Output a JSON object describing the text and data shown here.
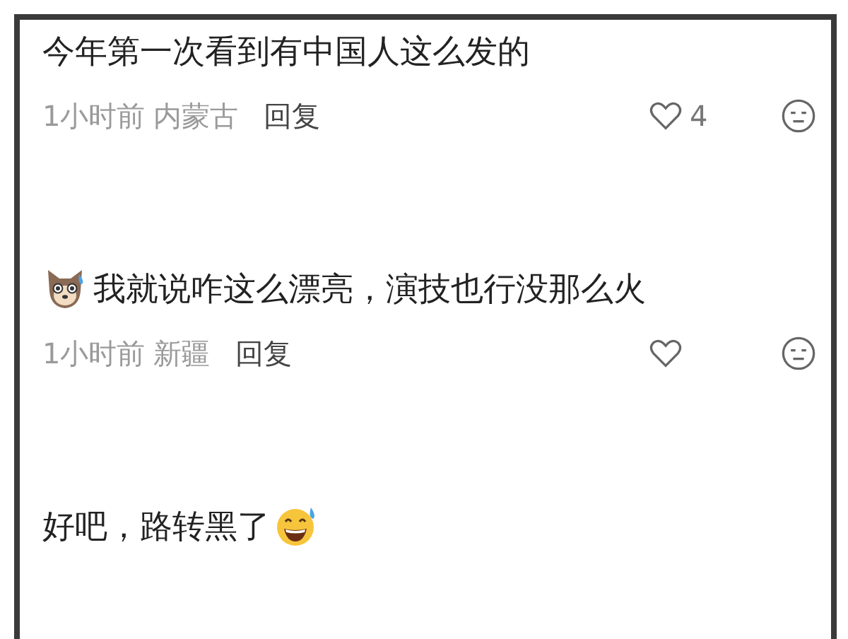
{
  "comments": [
    {
      "kind": "plain",
      "text": "今年第一次看到有中国人这么发的",
      "time": "1小时前",
      "location": "内蒙古",
      "reply": "回复",
      "likes": "4"
    },
    {
      "kind": "dog_lead",
      "text": "我就说咋这么漂亮，演技也行没那么火",
      "time": "1小时前",
      "location": "新疆",
      "reply": "回复"
    },
    {
      "kind": "sweat_trail",
      "text": "好吧，路转黑了"
    }
  ]
}
